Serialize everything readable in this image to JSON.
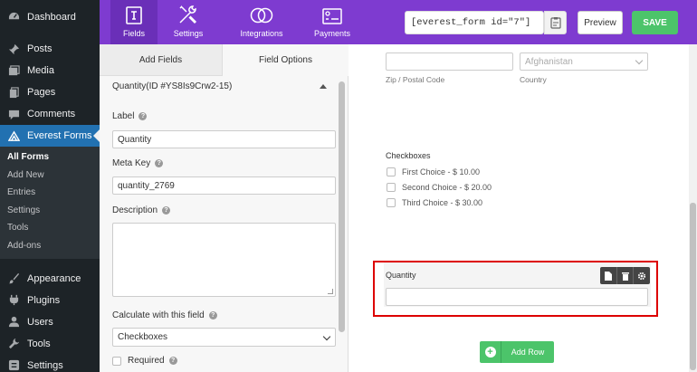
{
  "sidebar": {
    "items": [
      {
        "label": "Dashboard",
        "icon": "dashboard-icon"
      },
      {
        "label": "Posts",
        "icon": "pin-icon"
      },
      {
        "label": "Media",
        "icon": "media-icon"
      },
      {
        "label": "Pages",
        "icon": "pages-icon"
      },
      {
        "label": "Comments",
        "icon": "comment-icon"
      },
      {
        "label": "Everest Forms",
        "icon": "everest-forms-icon",
        "active": true
      }
    ],
    "submenu": [
      "All Forms",
      "Add New",
      "Entries",
      "Settings",
      "Tools",
      "Add-ons"
    ],
    "items_after": [
      {
        "label": "Appearance",
        "icon": "brush-icon"
      },
      {
        "label": "Plugins",
        "icon": "plugin-icon"
      },
      {
        "label": "Users",
        "icon": "user-icon"
      },
      {
        "label": "Tools",
        "icon": "wrench-icon"
      },
      {
        "label": "Settings",
        "icon": "settings-icon"
      }
    ]
  },
  "topbar": {
    "tabs": [
      {
        "label": "Fields",
        "icon": "fields-icon",
        "active": true
      },
      {
        "label": "Settings",
        "icon": "tools-icon"
      },
      {
        "label": "Integrations",
        "icon": "rings-icon"
      },
      {
        "label": "Payments",
        "icon": "payment-icon"
      }
    ],
    "shortcode": "[everest_form id=\"7\"]",
    "preview_label": "Preview",
    "save_label": "SAVE",
    "accent": "#7e3bd0"
  },
  "options": {
    "tabs": [
      "Add Fields",
      "Field Options"
    ],
    "section_title": "Quantity(ID #YS8Is9Crw2-15)",
    "label_title": "Label",
    "label_value": "Quantity",
    "meta_key_title": "Meta Key",
    "meta_key_value": "quantity_2769",
    "description_title": "Description",
    "calculate_title": "Calculate with this field",
    "calculate_value": "Checkboxes",
    "required_label": "Required"
  },
  "builder": {
    "country_value": "Afghanistan",
    "zip_label": "Zip / Postal Code",
    "country_label": "Country",
    "checkboxes_title": "Checkboxes",
    "choices": [
      "First Choice - $ 10.00",
      "Second Choice - $ 20.00",
      "Third Choice - $ 30.00"
    ],
    "quantity_label": "Quantity",
    "add_row_label": "Add Row"
  }
}
